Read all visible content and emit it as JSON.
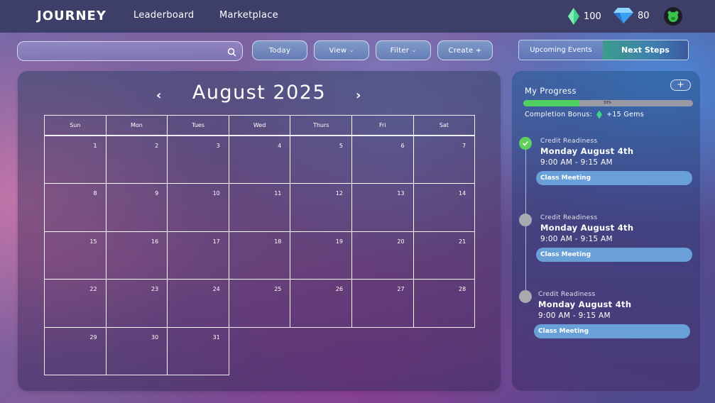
{
  "header": {
    "logo": "JOURNEY",
    "nav": [
      "Leaderboard",
      "Marketplace"
    ],
    "gems_green": "100",
    "gems_blue": "80"
  },
  "toolbar": {
    "search_placeholder": "",
    "today": "Today",
    "view": "View",
    "filter": "Filter",
    "create": "Create +",
    "tab_upcoming": "Upcoming Events",
    "tab_next": "Next Steps"
  },
  "calendar": {
    "month": "August 2025",
    "day_headers": [
      "Sun",
      "Mon",
      "Tues",
      "Wed",
      "Thurs",
      "Fri",
      "Sat"
    ],
    "days": [
      "1",
      "2",
      "3",
      "4",
      "5",
      "6",
      "7",
      "8",
      "9",
      "10",
      "11",
      "12",
      "13",
      "14",
      "15",
      "16",
      "17",
      "18",
      "19",
      "20",
      "21",
      "22",
      "23",
      "24",
      "25",
      "26",
      "27",
      "28",
      "29",
      "30",
      "31"
    ]
  },
  "side": {
    "progress_title": "My Progress",
    "progress_value": 0.33,
    "progress_label": "33%",
    "bonus_label": "Completion Bonus:",
    "bonus_value": "+15 Gems",
    "plus": "+",
    "events": [
      {
        "category": "Credit Readiness",
        "date": "Monday August 4th",
        "time": "9:00 AM - 9:15 AM",
        "tag": "Class Meeting",
        "done": true
      },
      {
        "category": "Credit Readiness",
        "date": "Monday August 4th",
        "time": "9:00 AM - 9:15 AM",
        "tag": "Class Meeting",
        "done": false
      },
      {
        "category": "Credit Readiness",
        "date": "Monday August 4th",
        "time": "9:00 AM - 9:15 AM",
        "tag": "Class Meeting",
        "done": false
      }
    ]
  },
  "colors": {
    "accent_green": "#4fd060",
    "pill_blue": "#6aa0d8",
    "topbar": "#3d3f68"
  }
}
